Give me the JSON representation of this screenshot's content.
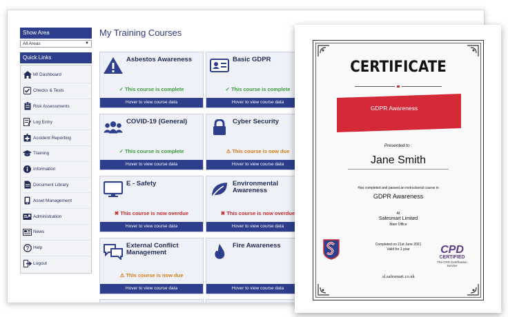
{
  "sidebar": {
    "show_area_label": "Show Area",
    "area_select_value": "All Areas",
    "quick_links_label": "Quick Links",
    "links": [
      {
        "label": "MI Dashboard",
        "icon": "home-icon"
      },
      {
        "label": "Checks & Tests",
        "icon": "checkbox-icon"
      },
      {
        "label": "Risk Assessments",
        "icon": "clipboard-icon"
      },
      {
        "label": "Log Entry",
        "icon": "log-entry-icon"
      },
      {
        "label": "Accident Reporting",
        "icon": "first-aid-icon"
      },
      {
        "label": "Training",
        "icon": "graduation-cap-icon"
      },
      {
        "label": "Information",
        "icon": "info-icon"
      },
      {
        "label": "Document Library",
        "icon": "document-icon"
      },
      {
        "label": "Asset Management",
        "icon": "device-icon"
      },
      {
        "label": "Administration",
        "icon": "admin-icon"
      },
      {
        "label": "News",
        "icon": "news-icon"
      },
      {
        "label": "Help",
        "icon": "help-icon"
      },
      {
        "label": "Logout",
        "icon": "logout-icon"
      }
    ]
  },
  "main": {
    "title": "My Training Courses",
    "hover_label": "Hover to view course data",
    "courses": [
      {
        "name": "Asbestos Awareness",
        "status": "This course is complete",
        "status_type": "complete",
        "icon": "warning-icon"
      },
      {
        "name": "Basic GDPR",
        "status": "This course is complete",
        "status_type": "complete",
        "icon": "id-card-icon"
      },
      {
        "name": "COVID-19 (General)",
        "status": "This course is complete",
        "status_type": "complete",
        "icon": "people-icon"
      },
      {
        "name": "Cyber Security",
        "status": "This course is now due",
        "status_type": "due",
        "icon": "lock-icon"
      },
      {
        "name": "E - Safety",
        "status": "This course is now overdue",
        "status_type": "overdue",
        "icon": "monitor-icon"
      },
      {
        "name": "Environmental Awareness",
        "status": "This course is now overdue",
        "status_type": "overdue",
        "icon": "leaf-icon"
      },
      {
        "name": "External Conflict Management",
        "status": "This course is now due",
        "status_type": "due",
        "icon": "chat-icon"
      },
      {
        "name": "Fire Awareness",
        "status": "",
        "status_type": "",
        "icon": "fire-icon"
      }
    ]
  },
  "certificate": {
    "title": "CERTIFICATE",
    "ribbon_text": "GDPR Awareness",
    "presented_to": "Presented to :",
    "recipient": "Jane Smith",
    "completion_text": "Has completed and passed an instructional course in",
    "course": "GDPR Awareness",
    "at": "At",
    "company": "Safesmart Limited",
    "office": "Main Office",
    "completed_on": "Completed on 21st June 2021",
    "valid_for": "Valid for 1 year",
    "website": "sl.safesmart.co.uk",
    "cpd_line1": "CPD",
    "cpd_line2": "CERTIFIED",
    "cpd_line3": "The CPD Certification",
    "cpd_line4": "Service"
  },
  "colors": {
    "brand_navy": "#2d3e8c",
    "complete_green": "#3a9a35",
    "due_orange": "#d97a14",
    "overdue_red": "#d02828",
    "ribbon_red": "#d42a38",
    "cpd_purple": "#5b3a8c"
  }
}
